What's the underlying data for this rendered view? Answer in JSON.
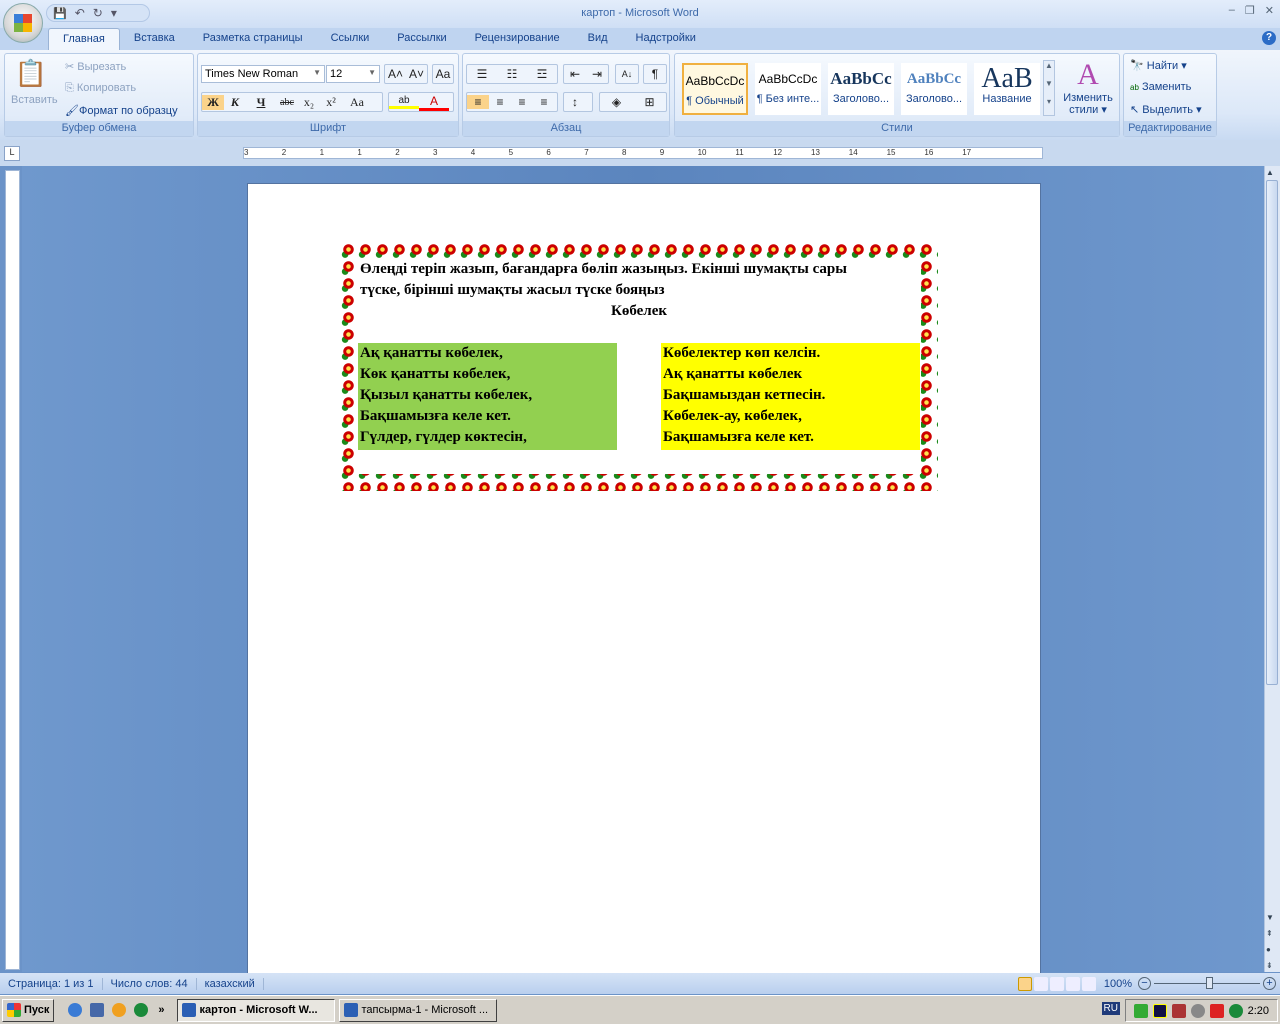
{
  "window": {
    "title": "картоп - Microsoft Word",
    "min": "–",
    "max": "❐",
    "close": "✕"
  },
  "qat": {
    "save": "💾",
    "undo": "↶",
    "redo": "↻",
    "more": "▾"
  },
  "tabs": [
    "Главная",
    "Вставка",
    "Разметка страницы",
    "Ссылки",
    "Рассылки",
    "Рецензирование",
    "Вид",
    "Надстройки"
  ],
  "help": "?",
  "clipboard": {
    "label": "Буфер обмена",
    "paste": "Вставить",
    "cut": "Вырезать",
    "copy": "Копировать",
    "format_painter": "Формат по образцу"
  },
  "font": {
    "label": "Шрифт",
    "name": "Times New Roman",
    "size": "12",
    "grow": "A˄",
    "shrink": "A˅",
    "clear": "Aa",
    "bold": "Ж",
    "italic": "К",
    "underline": "Ч",
    "strike": "abc",
    "sub": "x₂",
    "sup": "x²",
    "case": "Aa",
    "highlight": "ab",
    "color": "A",
    "highlight_color": "#ffff00",
    "font_color": "#ff0000"
  },
  "paragraph": {
    "label": "Абзац",
    "bullets": "☰",
    "numbering": "☷",
    "multilevel": "☲",
    "dec_indent": "⇤",
    "inc_indent": "⇥",
    "sort": "А↓",
    "pilcrow": "¶",
    "left": "≡",
    "center": "≡",
    "right": "≡",
    "justify": "≡",
    "spacing": "↕",
    "shading": "◈",
    "borders": "⊞"
  },
  "styles": {
    "label": "Стили",
    "items": [
      {
        "sample": "AaBbCcDc",
        "name": "¶ Обычный"
      },
      {
        "sample": "AaBbCcDc",
        "name": "¶ Без инте..."
      },
      {
        "sample": "AaBbCc",
        "name": "Заголово..."
      },
      {
        "sample": "AaBbCc",
        "name": "Заголово..."
      },
      {
        "sample": "AaB",
        "name": "Название"
      }
    ],
    "change": "Изменить стили ▾"
  },
  "editing": {
    "label": "Редактирование",
    "find": "Найти ▾",
    "replace": "Заменить",
    "select": "Выделить ▾"
  },
  "ruler": {
    "ticks": [
      "3",
      "2",
      "1",
      "1",
      "2",
      "3",
      "4",
      "5",
      "6",
      "7",
      "8",
      "9",
      "10",
      "11",
      "12",
      "13",
      "14",
      "15",
      "16",
      "17"
    ]
  },
  "document": {
    "instruction": "Өлеңді теріп жазып, бағандарға бөліп жазыңыз. Екінші шумақты сары",
    "instruction2": "түске, бірінші шумақты жасыл түске бояңыз",
    "heading": "Көбелек",
    "col1": [
      "Ақ қанатты көбелек,",
      "Көк қанатты көбелек,",
      "Қызыл қанатты көбелек,",
      "Бақшамызға келе кет.",
      "Гүлдер, гүлдер көктесін,"
    ],
    "col2": [
      "Көбелектер көп келсін.",
      "Ақ қанатты көбелек",
      "Бақшамыздан кетпесін.",
      "Көбелек-ау, көбелек,",
      "Бақшамызға келе кет."
    ],
    "col1_color": "#92d050",
    "col2_color": "#ffff00"
  },
  "status": {
    "page": "Страница: 1 из 1",
    "words": "Число слов: 44",
    "lang": "казахский",
    "zoom": "100%",
    "zoom_level": 100
  },
  "taskbar": {
    "start": "Пуск",
    "more": "»",
    "tasks": [
      "картоп - Microsoft W...",
      "тапсырма-1 - Microsoft ..."
    ],
    "lang": "RU",
    "time": "2:20"
  }
}
